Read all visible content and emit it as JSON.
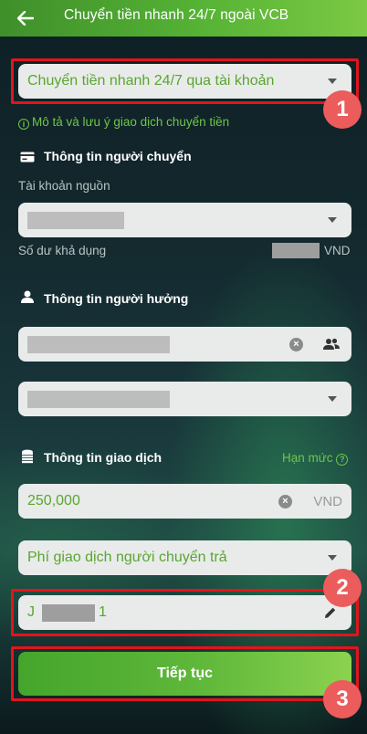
{
  "header": {
    "title": "Chuyển tiền nhanh 24/7 ngoài VCB"
  },
  "transfer_type": {
    "value": "Chuyển tiền nhanh 24/7 qua tài khoản"
  },
  "note_link": "Mô tả và lưu ý giao dịch chuyển tiền",
  "sender": {
    "section_title": "Thông tin người chuyển",
    "source_account_label": "Tài khoản nguồn",
    "balance_label": "Số dư khả dụng",
    "balance_currency": "VND"
  },
  "beneficiary": {
    "section_title": "Thông tin người hưởng"
  },
  "transaction": {
    "section_title": "Thông tin giao dịch",
    "limit_link": "Hạn mức",
    "amount": "250,000",
    "amount_currency": "VND",
    "fee_option": "Phí giao dịch người chuyển trả",
    "content_prefix": "J",
    "content_suffix": "1"
  },
  "continue_button": "Tiếp tục",
  "badges": [
    "1",
    "2",
    "3"
  ],
  "colors": {
    "accent_green": "#5aa62f",
    "highlight_red": "#e3141c",
    "badge_red": "#ec5c5c"
  }
}
